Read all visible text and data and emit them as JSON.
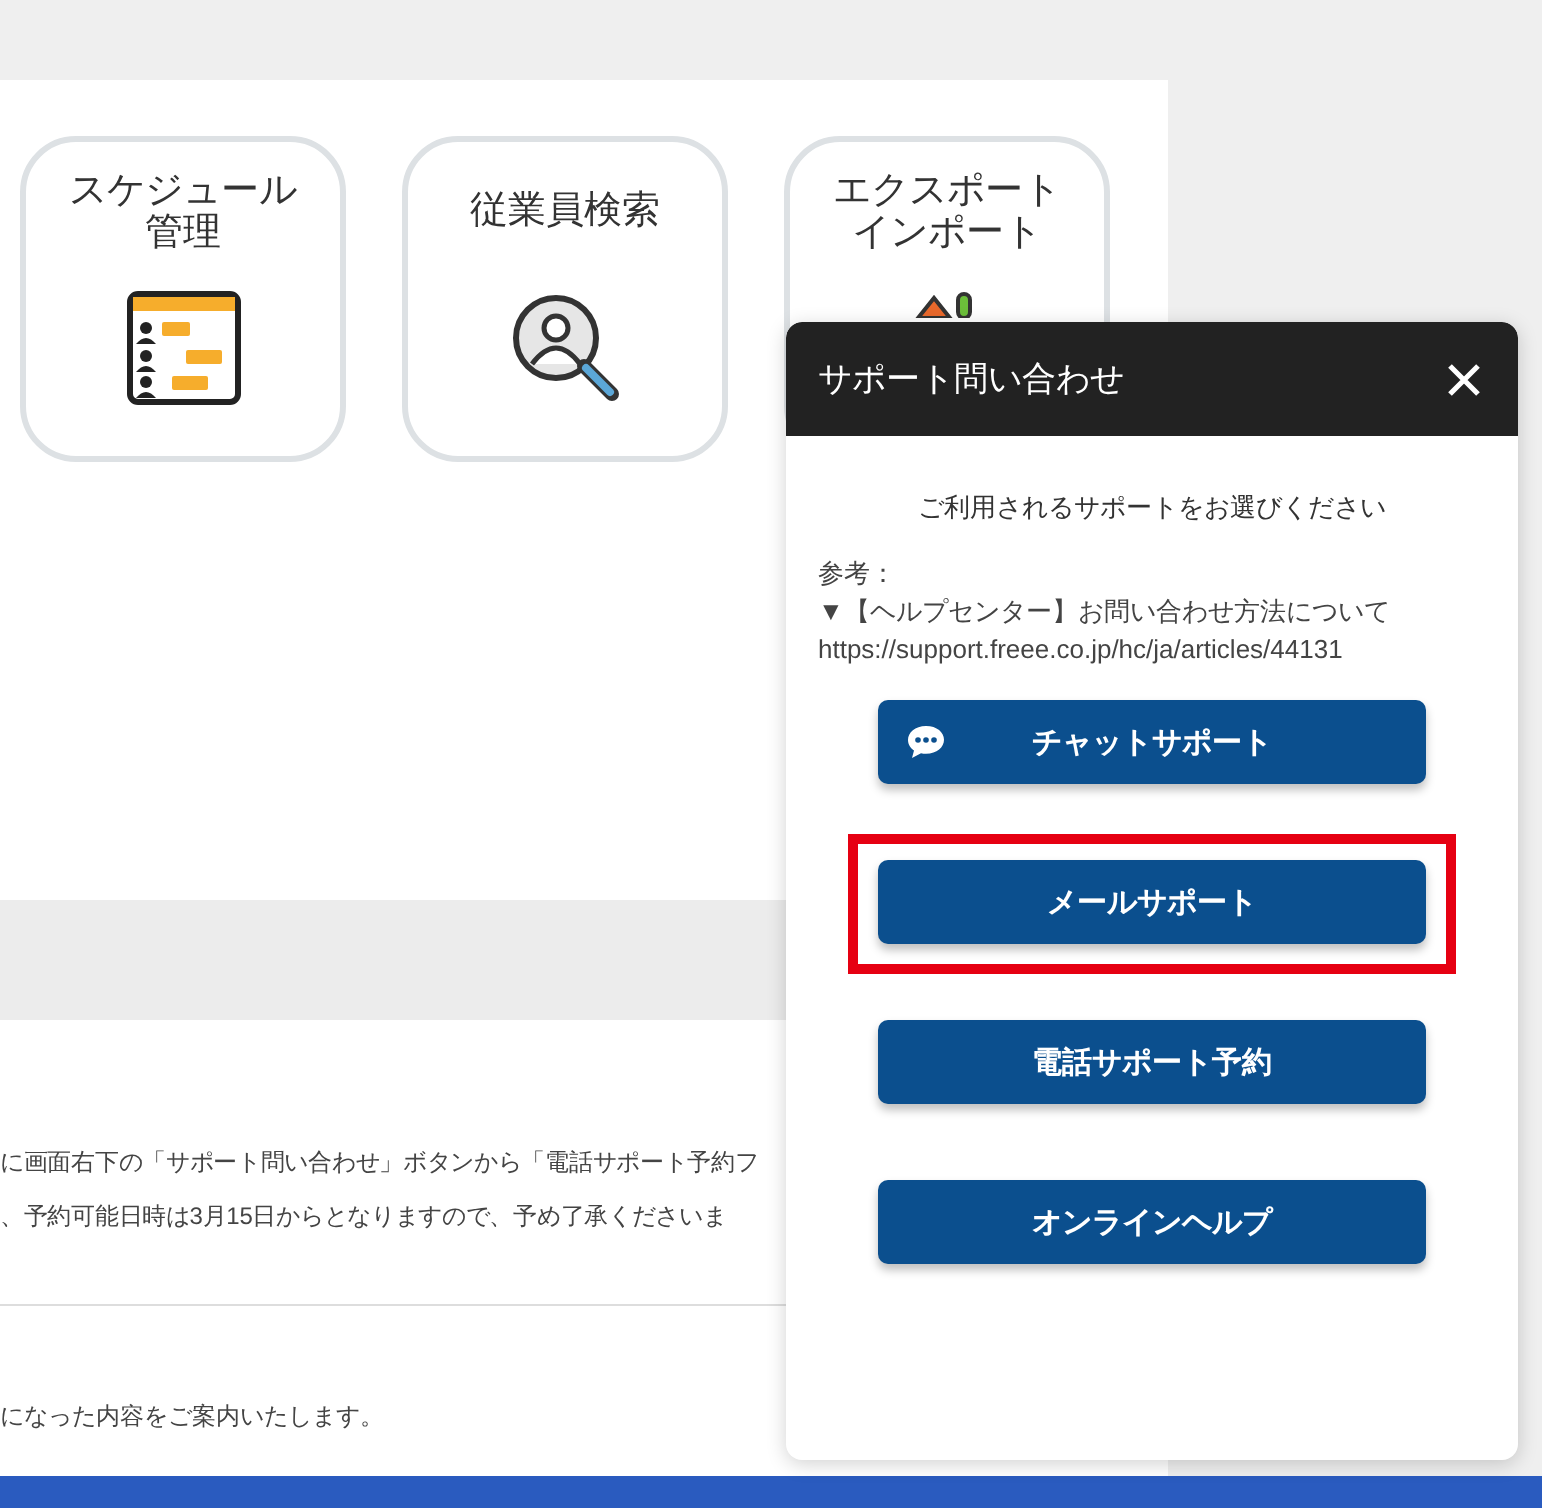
{
  "tiles": [
    {
      "label_lines": [
        "スケジュール",
        "管理"
      ],
      "kind": "schedule"
    },
    {
      "label_lines": [
        "従業員検索"
      ],
      "kind": "employee_search"
    },
    {
      "label_lines": [
        "エクスポート",
        "インポート"
      ],
      "kind": "export"
    }
  ],
  "notice_lines": [
    "に画面右下の「サポート問い合わせ」ボタンから「電話サポート予約フ",
    "、予約可能日時は3月15日からとなりますので、予め了承くださいま"
  ],
  "footer_text": "になった内容をご案内いたします。",
  "support_popup": {
    "title": "サポート問い合わせ",
    "prompt": "ご利用されるサポートをお選びください",
    "reference_label": "参考：",
    "reference_link": "▼【ヘルプセンター】お問い合わせ方法について",
    "reference_url": "https://support.freee.co.jp/hc/ja/articles/44131",
    "buttons": [
      {
        "label": "チャットサポート",
        "kind": "chat",
        "highlighted": false
      },
      {
        "label": "メールサポート",
        "kind": "plain",
        "highlighted": true
      },
      {
        "label": "電話サポート予約",
        "kind": "plain",
        "highlighted": false
      },
      {
        "label": "オンラインヘルプ",
        "kind": "plain",
        "highlighted": false
      }
    ]
  }
}
